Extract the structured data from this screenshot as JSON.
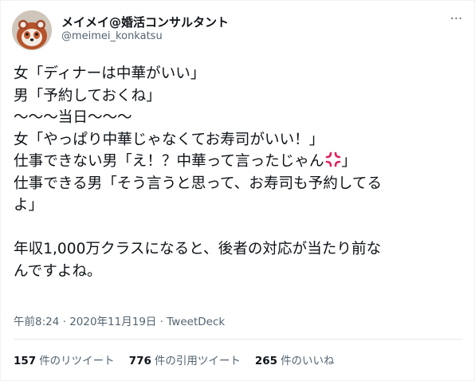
{
  "author": {
    "display_name": "メイメイ@婚活コンサルタント",
    "handle": "@meimei_konkatsu"
  },
  "menu_icon_text": "⋯",
  "tweet": {
    "lines": [
      "女「ディナーは中華がいい」",
      "男「予約しておくね」",
      "〜〜〜当日〜〜〜",
      "女「やっぱり中華じゃなくてお寿司がいい！」",
      "仕事できない男「え！？中華って言ったじゃん",
      "」",
      "仕事できる男「そう言うと思って、お寿司も予約してる",
      "よ」",
      "年収1,000万クラスになると、後者の対応が当たり前な",
      "んですよね。"
    ]
  },
  "meta": {
    "time": "午前8:24",
    "separator": " · ",
    "date": "2020年11月19日",
    "source": "TweetDeck"
  },
  "stats": {
    "retweets_count": "157",
    "retweets_label": "件のリツイート",
    "quotes_count": "776",
    "quotes_label": "件の引用ツイート",
    "likes_count": "265",
    "likes_label": "件のいいね"
  },
  "colors": {
    "text": "#0f1419",
    "muted": "#536471",
    "anger": "#e0245e",
    "divider": "#e1e8ed"
  }
}
